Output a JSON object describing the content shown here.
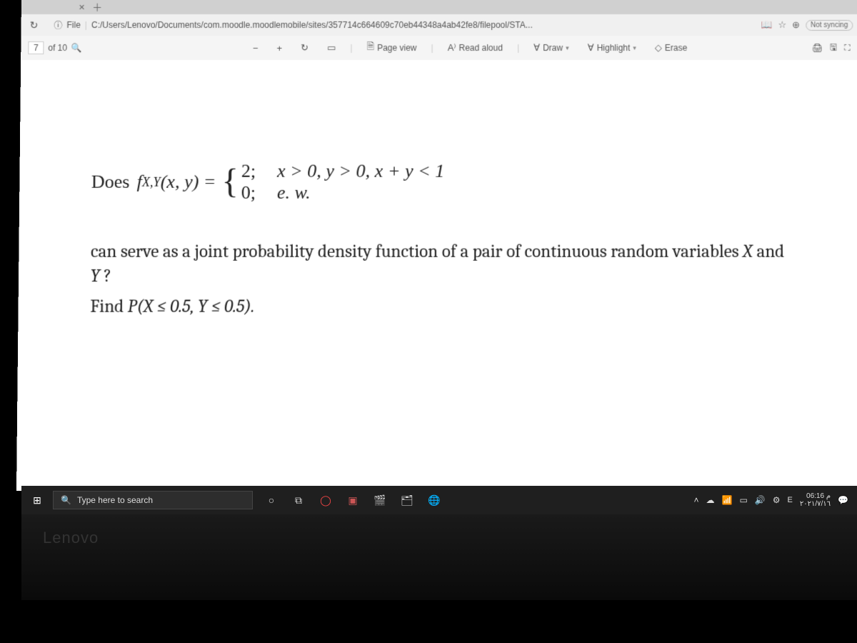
{
  "browser": {
    "url_prefix": "File",
    "url": "C:/Users/Lenovo/Documents/com.moodle.moodlemobile/sites/357714c664609c70eb44348a4ab42fe8/filepool/STA...",
    "sync": "Not syncing"
  },
  "pdf": {
    "page_current": "7",
    "page_of": "of 10",
    "btn_pageview": "Page view",
    "btn_readaloud": "Read aloud",
    "btn_draw": "Draw",
    "btn_highlight": "Highlight",
    "btn_erase": "Erase"
  },
  "doc": {
    "does": "Does ",
    "f": "f",
    "sub": "X,Y",
    "args": "(x, y) = ",
    "case1_val": "2;",
    "case1_cond": "x > 0, y > 0, x + y < 1",
    "case2_val": "0;",
    "case2_cond": "e. w.",
    "p1": "can serve as a joint probability density function of a pair of continuous random variables ",
    "X": "X",
    "and": " and ",
    "Y": "Y",
    "q": " ?",
    "find": "Find ",
    "P": "P",
    "pexpr": "(X ≤ 0.5, Y ≤ 0.5)."
  },
  "taskbar": {
    "search": "Type here to search",
    "lang": "E",
    "time": "06:16 م",
    "date": "۲۰۲۱/۷/۱٦"
  },
  "brand": "Lenovo"
}
